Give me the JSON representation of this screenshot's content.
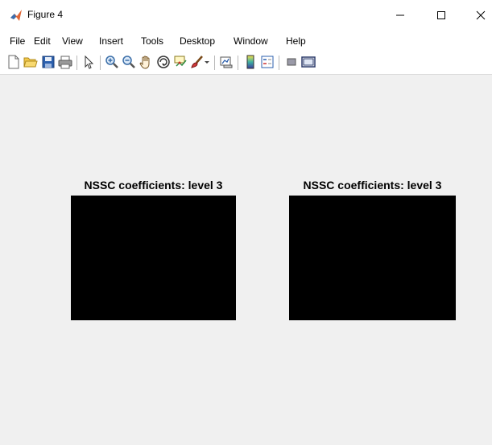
{
  "window": {
    "title": "Figure 4",
    "controls": [
      "minimize",
      "maximize",
      "close"
    ]
  },
  "menubar": {
    "items": [
      "File",
      "Edit",
      "View",
      "Insert",
      "Tools",
      "Desktop",
      "Window",
      "Help"
    ]
  },
  "toolbar": {
    "icons": [
      "new-figure-icon",
      "open-file-icon",
      "save-icon",
      "print-icon",
      "edit-plot-icon",
      "zoom-in-icon",
      "zoom-out-icon",
      "pan-icon",
      "rotate-3d-icon",
      "data-cursor-icon",
      "brush-icon",
      "brush-dropdown-icon",
      "link-plot-icon",
      "insert-colorbar-icon",
      "insert-legend-icon",
      "hide-plot-tools-icon",
      "show-plot-tools-icon"
    ]
  },
  "axes": [
    {
      "title": "NSSC coefficients: level 3"
    },
    {
      "title": "NSSC coefficients: level 3"
    }
  ],
  "colors": {
    "figure_background": "#f0f0f0",
    "image_fill": "#000000",
    "matlab_icon_orange": "#e16737"
  }
}
